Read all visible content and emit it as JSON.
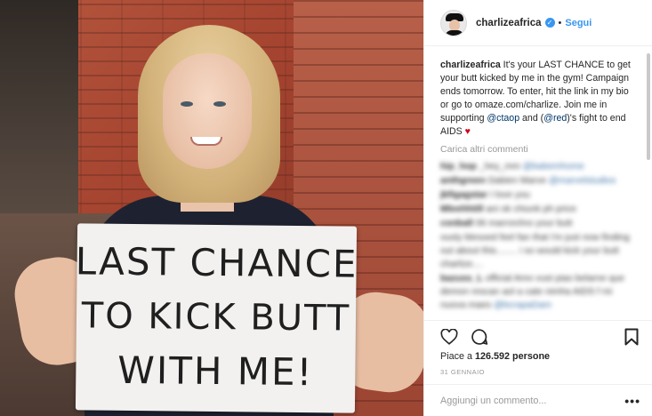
{
  "photo": {
    "sign_lines": [
      "LAST CHANCE",
      "TO KICK BUTT",
      "WITH ME!"
    ]
  },
  "header": {
    "username": "charlizeafrica",
    "verified_icon": "verified-badge-icon",
    "separator": "•",
    "follow_label": "Segui"
  },
  "caption": {
    "username": "charlizeafrica",
    "text_1": " It's your LAST CHANCE to get your butt kicked by me in the gym! Campaign ends tomorrow. To enter, hit the link in my bio or go to omaze.com/charlize. Join me in supporting ",
    "mention_1": "@ctaop",
    "text_2": " and (",
    "mention_2": "@red",
    "text_3": ")'s fight to end AIDS ",
    "heart": "♥"
  },
  "load_more_label": "Carica altri commenti",
  "blurred_comments": [
    {
      "user": "hip_hop",
      "text": "_hey_mm ",
      "link": "@babemhome"
    },
    {
      "user": "anthgreen",
      "text": "Dabien Marve ",
      "link": "@marvelstudios"
    },
    {
      "user": "jkfigagstar",
      "text": "I love you",
      "link": ""
    },
    {
      "user": "Mleehhtill",
      "text": "ani  ok chiunk ph price",
      "link": ""
    },
    {
      "user": "conball",
      "text": "06 marron/ino your butt",
      "link": ""
    },
    {
      "user": "",
      "text": "ously blessed feel fan that i'm just now finding out about this........ i so would kick your butt charlize.... ",
      "link": ""
    },
    {
      "user": "bazuss_L",
      "text": "official Amo vust pias belarne que demon rescan aol a cate nimha AIDS f mi nuova maes ",
      "link": "@bcrapaDam"
    }
  ],
  "actions": {
    "like_icon": "heart-outline-icon",
    "comment_icon": "comment-bubble-icon",
    "save_icon": "bookmark-icon"
  },
  "likes": {
    "prefix": "Piace a ",
    "count": "126.592",
    "suffix": " persone"
  },
  "date": "31 GENNAIO",
  "add_comment": {
    "placeholder": "Aggiungi un commento...",
    "more_label": "•••"
  },
  "colors": {
    "accent": "#3897f0",
    "mention": "#003569",
    "heart": "#d0021b",
    "muted": "#999999"
  }
}
